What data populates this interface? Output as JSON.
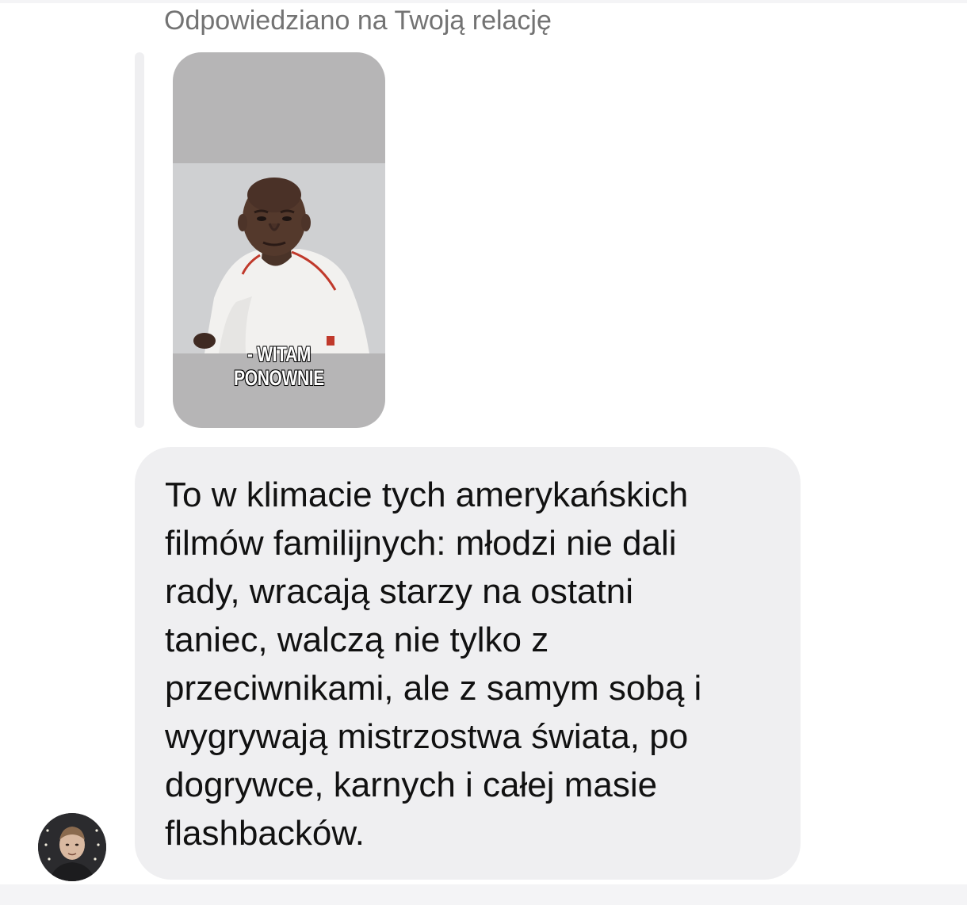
{
  "thread": {
    "reply_label": "Odpowiedziano na Twoją relację",
    "story": {
      "caption_line1": "- WITAM",
      "caption_line2": "PONOWNIE"
    },
    "message": {
      "text": "To w klimacie tych amerykańskich\nfilmów familijnych: młodzi nie dali\nrady, wracają starzy na ostatni\ntaniec, walczą nie tylko z\nprzeciwnikami, ale z samym sobą i\nwygrywają mistrzostwa świata, po\ndogrywce, karnych i całej masie\nflashbacków."
    }
  },
  "colors": {
    "bubble_bg": "#efeff1",
    "label_gray": "#737373",
    "story_bg": "#b6b5b6"
  }
}
